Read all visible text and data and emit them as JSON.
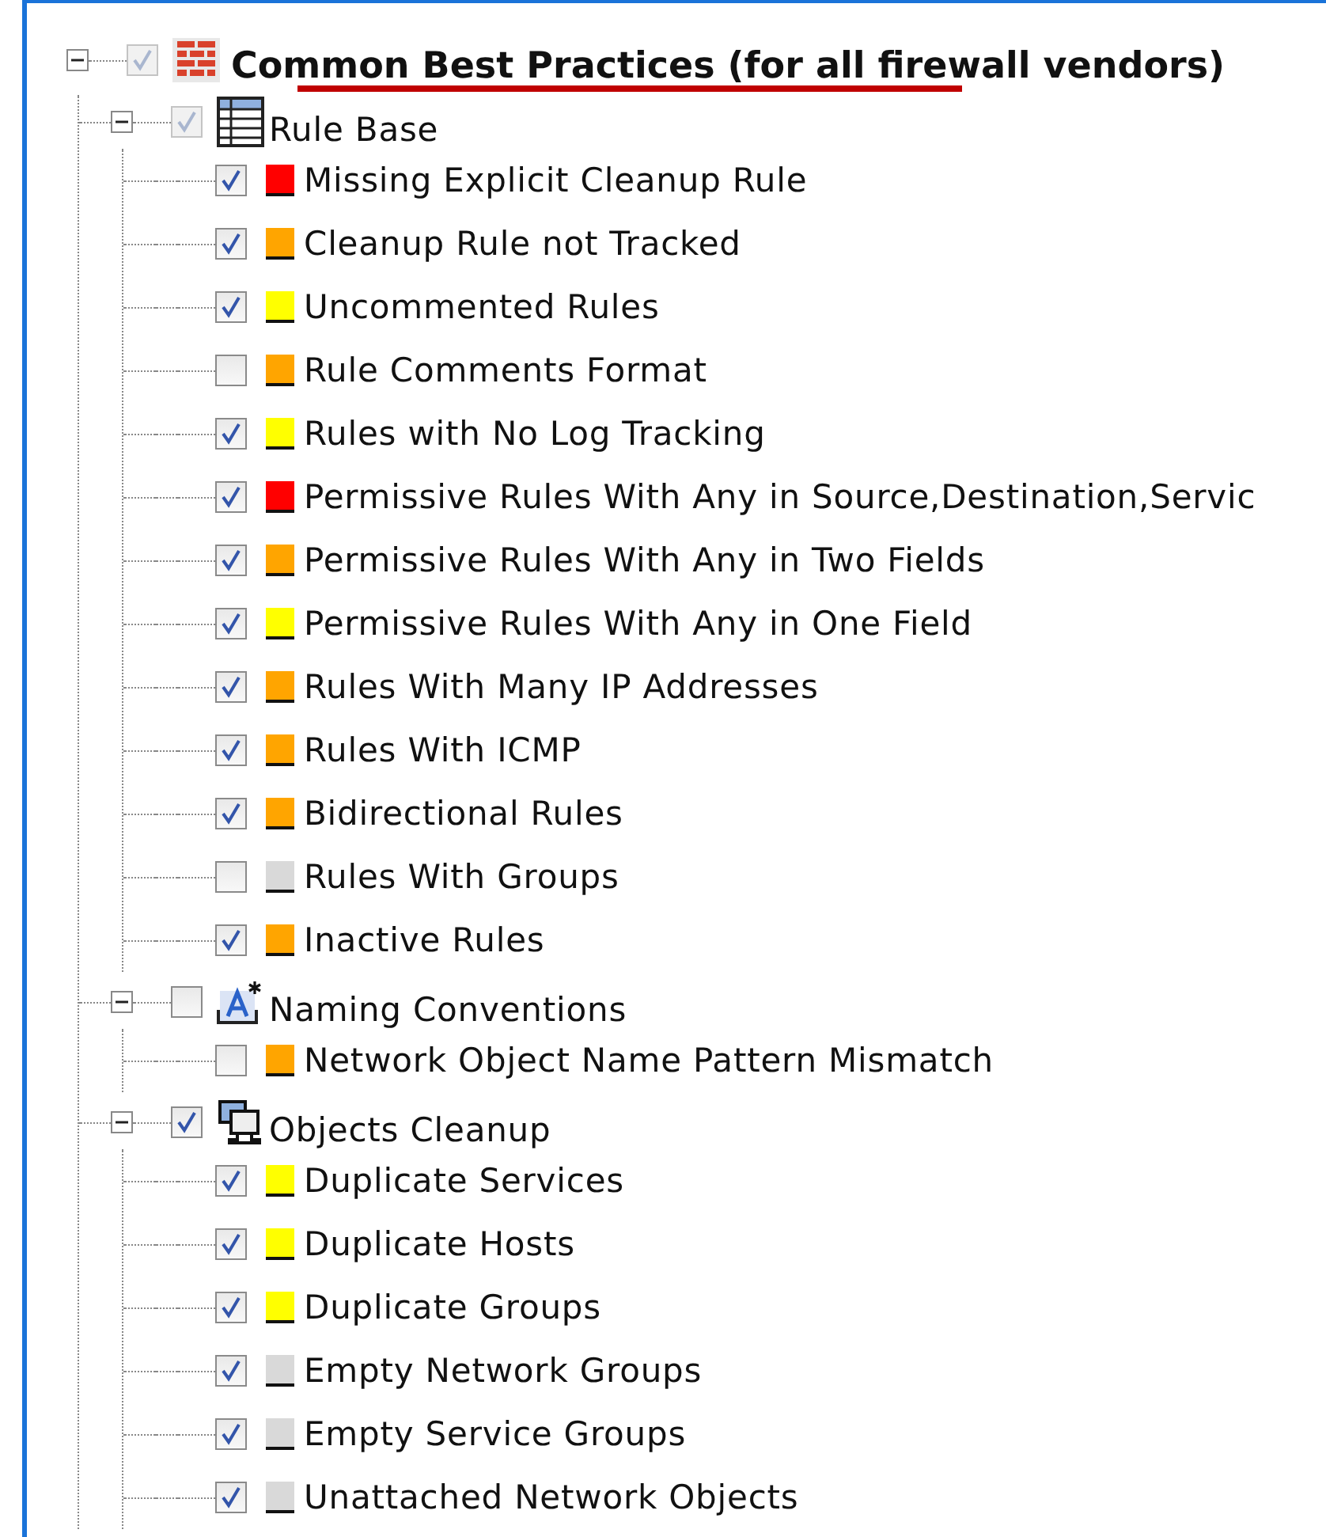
{
  "tree": {
    "kind": "firewall",
    "label": "Common Best Practices (for all firewall vendors)",
    "expanded": true,
    "checked": true,
    "partial": true,
    "children": [
      {
        "kind": "table",
        "label": "Rule Base",
        "expanded": true,
        "checked": true,
        "partial": true,
        "children": [
          {
            "label": "Missing Explicit Cleanup Rule",
            "checked": true,
            "color": "#ff0000"
          },
          {
            "label": "Cleanup Rule not Tracked",
            "checked": true,
            "color": "#ffa500"
          },
          {
            "label": "Uncommented Rules",
            "checked": true,
            "color": "#ffff00"
          },
          {
            "label": "Rule Comments Format",
            "checked": false,
            "color": "#ffa500"
          },
          {
            "label": "Rules with No Log Tracking",
            "checked": true,
            "color": "#ffff00"
          },
          {
            "label": "Permissive Rules With Any in Source,Destination,Servic",
            "checked": true,
            "color": "#ff0000"
          },
          {
            "label": "Permissive Rules With Any in Two Fields",
            "checked": true,
            "color": "#ffa500"
          },
          {
            "label": "Permissive Rules With Any in One Field",
            "checked": true,
            "color": "#ffff00"
          },
          {
            "label": "Rules With Many IP Addresses",
            "checked": true,
            "color": "#ffa500"
          },
          {
            "label": "Rules With ICMP",
            "checked": true,
            "color": "#ffa500"
          },
          {
            "label": "Bidirectional Rules",
            "checked": true,
            "color": "#ffa500"
          },
          {
            "label": "Rules With Groups",
            "checked": false,
            "color": "#d9d9d9"
          },
          {
            "label": "Inactive Rules",
            "checked": true,
            "color": "#ffa500"
          }
        ]
      },
      {
        "kind": "naming",
        "label": "Naming Conventions",
        "expanded": true,
        "checked": false,
        "partial": false,
        "children": [
          {
            "label": "Network Object Name Pattern Mismatch",
            "checked": false,
            "color": "#ffa500"
          }
        ]
      },
      {
        "kind": "objects",
        "label": "Objects Cleanup",
        "expanded": true,
        "checked": true,
        "partial": false,
        "children": [
          {
            "label": "Duplicate Services",
            "checked": true,
            "color": "#ffff00"
          },
          {
            "label": "Duplicate Hosts",
            "checked": true,
            "color": "#ffff00"
          },
          {
            "label": "Duplicate Groups",
            "checked": true,
            "color": "#ffff00"
          },
          {
            "label": "Empty Network Groups",
            "checked": true,
            "color": "#d9d9d9"
          },
          {
            "label": "Empty Service Groups",
            "checked": true,
            "color": "#d9d9d9"
          },
          {
            "label": "Unattached Network Objects",
            "checked": true,
            "color": "#d9d9d9"
          }
        ]
      }
    ]
  }
}
